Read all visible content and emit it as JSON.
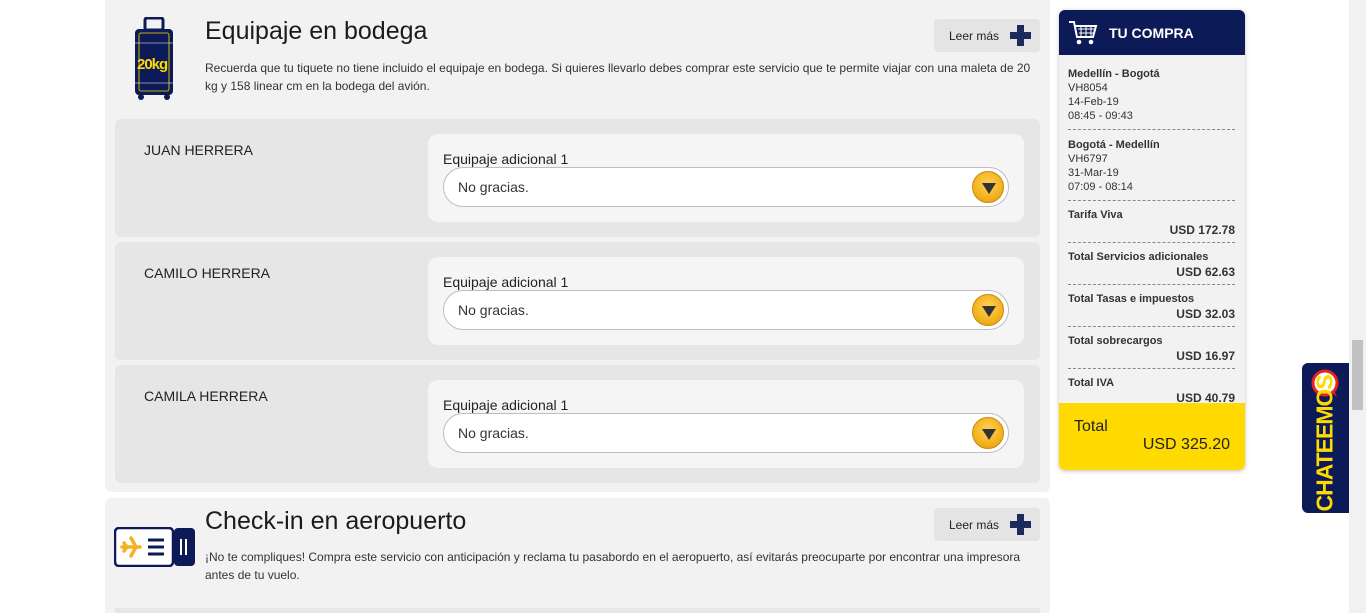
{
  "baggage": {
    "title": "Equipaje en bodega",
    "description": "Recuerda que tu tiquete no tiene incluido el equipaje en bodega. Si quieres llevarlo debes comprar este servicio que te permite viajar con una maleta de 20 kg y 158 linear cm en la bodega del avión.",
    "more_label": "Leer más",
    "icon_weight_text": "20kg",
    "passengers": [
      {
        "name": "JUAN HERRERA",
        "field_label": "Equipaje adicional 1",
        "selected": "No gracias."
      },
      {
        "name": "CAMILO HERRERA",
        "field_label": "Equipaje adicional 1",
        "selected": "No gracias."
      },
      {
        "name": "CAMILA HERRERA",
        "field_label": "Equipaje adicional 1",
        "selected": "No gracias."
      }
    ]
  },
  "checkin": {
    "title": "Check-in en aeropuerto",
    "description": "¡No te compliques! Compra este servicio con anticipación y reclama tu pasabordo en el aeropuerto, así evitarás preocuparte por encontrar una impresora antes de tu vuelo.",
    "more_label": "Leer más"
  },
  "cart": {
    "title": "TU COMPRA",
    "segments": [
      {
        "route": "Medellín - Bogotá",
        "flight": "VH8054",
        "date": "14-Feb-19",
        "time": "08:45 - 09:43"
      },
      {
        "route": "Bogotá - Medellín",
        "flight": "VH6797",
        "date": "31-Mar-19",
        "time": "07:09 - 08:14"
      }
    ],
    "costs": [
      {
        "label": "Tarifa Viva",
        "amount": "USD 172.78"
      },
      {
        "label": "Total Servicios adicionales",
        "amount": "USD 62.63"
      },
      {
        "label": "Total Tasas e impuestos",
        "amount": "USD 32.03"
      },
      {
        "label": "Total sobrecargos",
        "amount": "USD 16.97"
      },
      {
        "label": "Total IVA",
        "amount": "USD 40.79"
      }
    ],
    "total_label": "Total",
    "total_amount": "USD 325.20"
  },
  "chat": {
    "label": "CHATEEMOS"
  },
  "colors": {
    "navy": "#0c1b58",
    "yellow": "#ffda00",
    "orange": "#f3b21e"
  },
  "icons": [
    "suitcase-icon",
    "boarding-pass-icon",
    "plus-icon",
    "cart-icon",
    "chat-bubble-icon",
    "chevron-down-icon"
  ]
}
